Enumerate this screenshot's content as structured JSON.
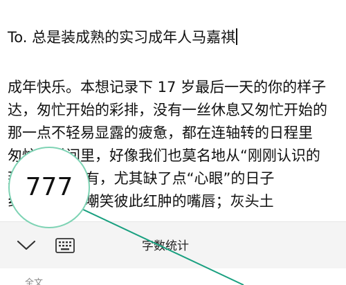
{
  "document": {
    "title": "To. 总是装成熟的实习成年人马嘉祺",
    "lines": [
      "成年快乐。本想记录下 17 岁最后一天的你的样子",
      "达，匆忙开始的彩排，没有一丝休息又匆忙开始的",
      "那一点不轻易显露的疲惫，都在连轴转的日程里",
      "匆忙的时间里，好像我们也莫名地从“刚刚认识的",
      "那     什么都没有，尤其缺了点“心眼”的日子",
      "纟     着鸡窝头嘲笑彼此红肿的嘴唇；灰头土"
    ]
  },
  "toolbar": {
    "title": "字数统计",
    "collapse_icon": "chevron-down-icon",
    "keyboard_icon": "keyboard-icon"
  },
  "footer": {
    "label": "全文"
  },
  "callout": {
    "value": "777"
  },
  "colors": {
    "callout_border": "#7ed3b4",
    "pointer_line": "#1aa080",
    "toolbar_bg": "#f4f4f4"
  }
}
